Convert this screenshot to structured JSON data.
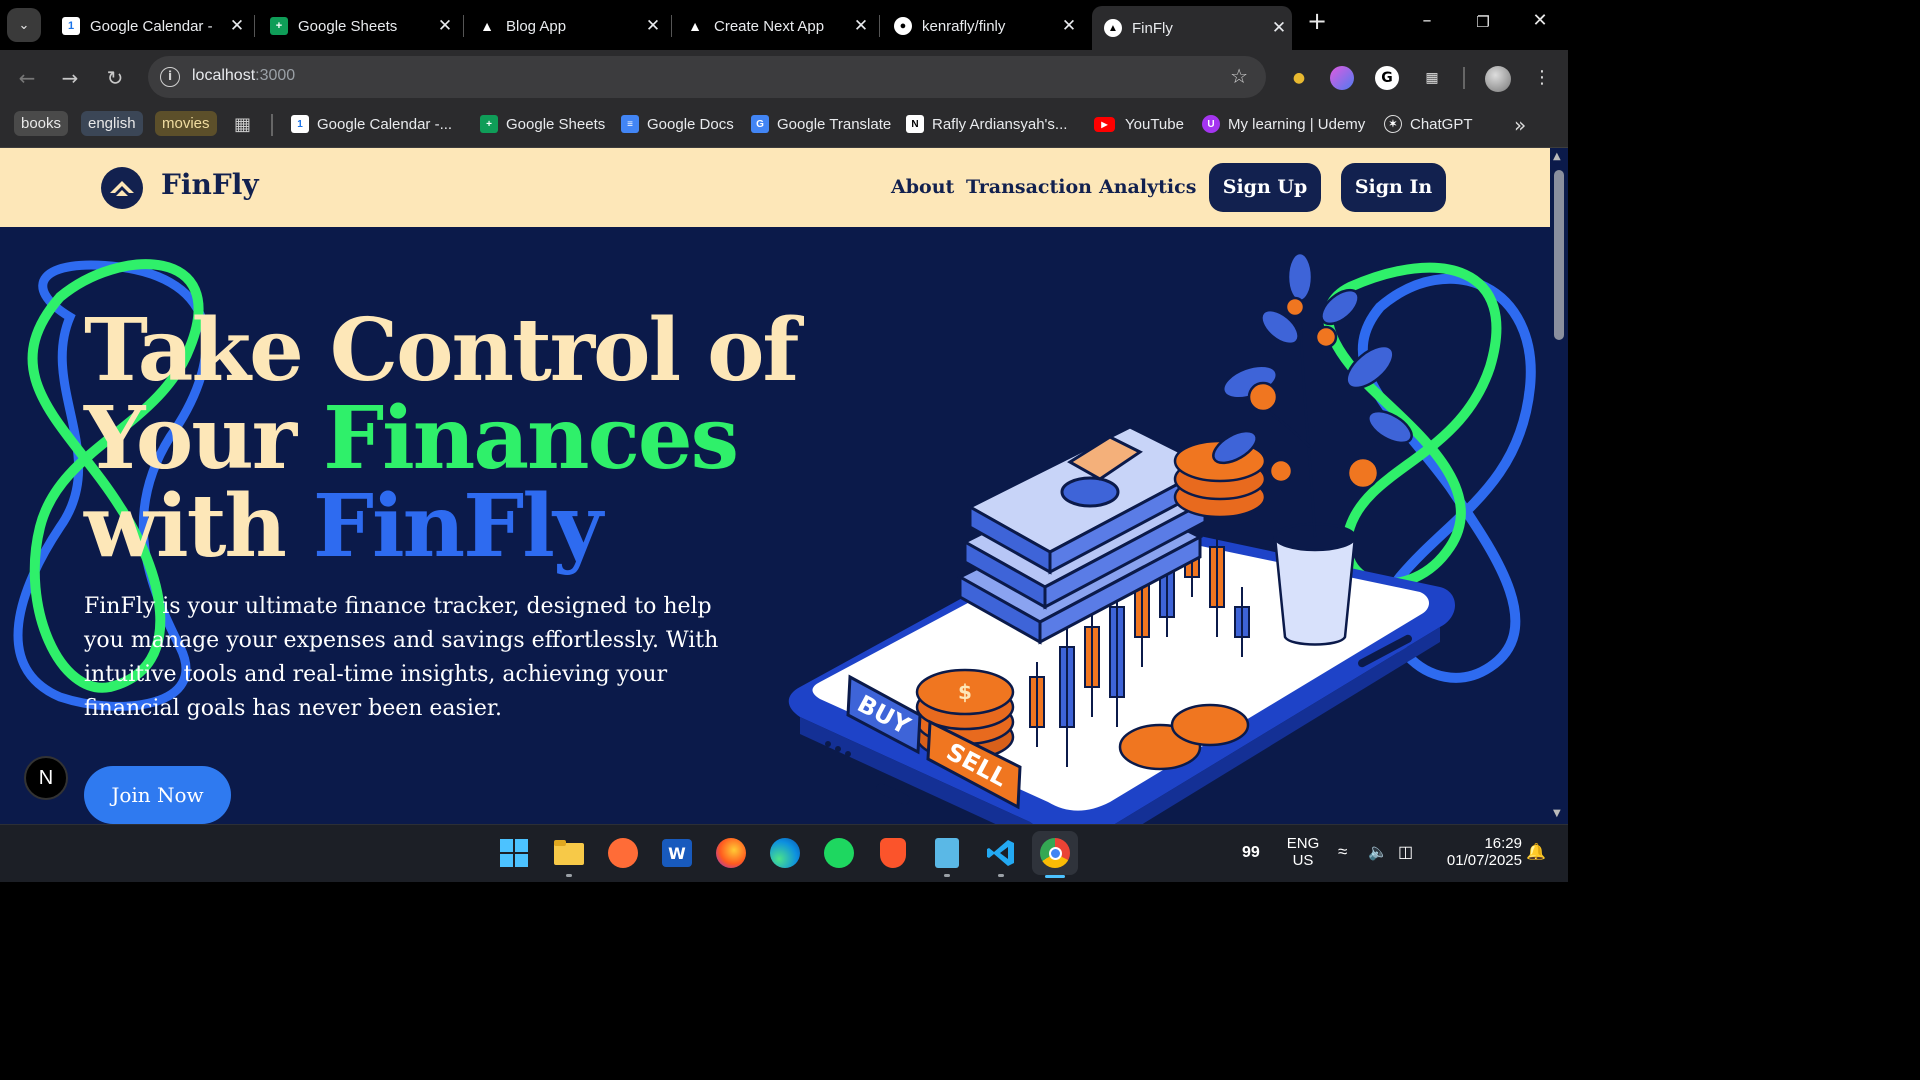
{
  "tabs": [
    {
      "title": "Google Calendar -",
      "icon": "google-calendar-icon"
    },
    {
      "title": "Google Sheets",
      "icon": "google-sheets-icon"
    },
    {
      "title": "Blog App",
      "icon": "vercel-triangle-icon"
    },
    {
      "title": "Create Next App",
      "icon": "vercel-triangle-icon"
    },
    {
      "title": "kenrafly/finly",
      "icon": "github-icon"
    },
    {
      "title": "FinFly",
      "icon": "vercel-triangle-icon",
      "active": true
    }
  ],
  "address": {
    "host": "localhost",
    "port": ":3000"
  },
  "bookmarks": {
    "folders": [
      "books",
      "english",
      "movies"
    ],
    "items": [
      {
        "label": "Google Calendar -...",
        "icon": "google-calendar-icon"
      },
      {
        "label": "Google Sheets",
        "icon": "google-sheets-icon"
      },
      {
        "label": "Google Docs",
        "icon": "google-docs-icon"
      },
      {
        "label": "Google Translate",
        "icon": "google-translate-icon"
      },
      {
        "label": "Rafly Ardiansyah's...",
        "icon": "notion-icon"
      },
      {
        "label": "YouTube",
        "icon": "youtube-icon"
      },
      {
        "label": "My learning | Udemy",
        "icon": "udemy-icon"
      },
      {
        "label": "ChatGPT",
        "icon": "chatgpt-icon"
      }
    ]
  },
  "site": {
    "brand": "FinFly",
    "nav": [
      "About",
      "Transaction",
      "Analytics"
    ],
    "signup": "Sign Up",
    "signin": "Sign In"
  },
  "hero": {
    "title_line1": "Take Control of",
    "title_line2_a": "Your ",
    "title_line2_b": "Finances",
    "title_line3_a": "with ",
    "title_line3_b": "FinFly",
    "description": "FinFly is your ultimate finance tracker, designed to help you manage your expenses and savings effortlessly. With intuitive tools and real-time insights, achieving your financial goals has never been easier.",
    "cta": "Join Now",
    "illustration_buy": "BUY",
    "illustration_sell": "SELL"
  },
  "next_badge": "N",
  "taskbar": {
    "badge_count": "99",
    "lang_line1": "ENG",
    "lang_line2": "US",
    "time": "16:29",
    "date": "01/07/2025"
  },
  "colors": {
    "header_bg": "#fde7b8",
    "hero_bg": "#0b1a4a",
    "navy": "#12214f",
    "accent_green": "#2ff06a",
    "accent_blue": "#2e6bf0",
    "cta_blue": "#2f7af0"
  }
}
